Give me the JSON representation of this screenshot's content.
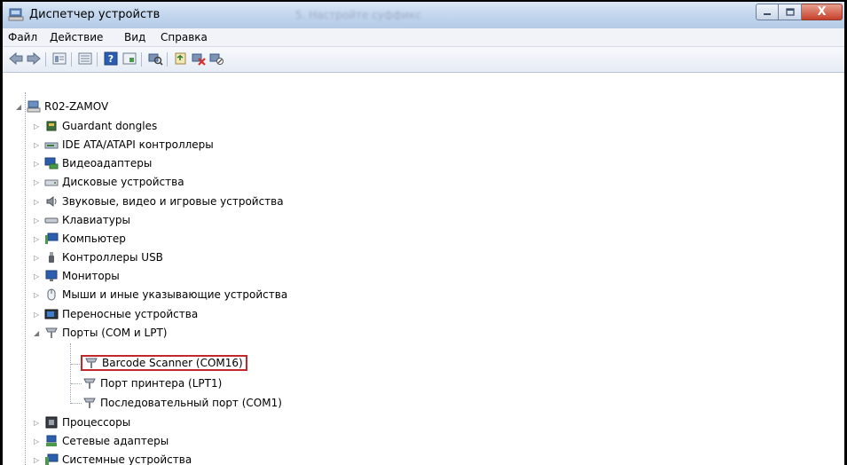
{
  "window": {
    "title": "Диспетчер устройств",
    "ghost_title": "5. Настройте суффикс",
    "close_glyph": "X"
  },
  "menu": [
    {
      "label": "Файл"
    },
    {
      "label": "Действие"
    },
    {
      "label": "Вид"
    },
    {
      "label": "Справка"
    }
  ],
  "toolbar": {
    "icons": [
      "back-icon",
      "forward-icon",
      "properties-pane-icon",
      "list-view-icon",
      "help-icon",
      "device-props-icon",
      "scan-hardware-icon",
      "update-driver-icon",
      "uninstall-icon",
      "disable-icon"
    ]
  },
  "tree": {
    "root": {
      "label": "R02-ZAMOV",
      "expanded": true
    },
    "categories": [
      {
        "label": "Guardant dongles",
        "icon": "dongle-icon"
      },
      {
        "label": "IDE ATA/ATAPI контроллеры",
        "icon": "ide-controller-icon"
      },
      {
        "label": "Видеоадаптеры",
        "icon": "display-adapter-icon"
      },
      {
        "label": "Дисковые устройства",
        "icon": "disk-drive-icon"
      },
      {
        "label": "Звуковые, видео и игровые устройства",
        "icon": "speaker-icon"
      },
      {
        "label": "Клавиатуры",
        "icon": "keyboard-icon"
      },
      {
        "label": "Компьютер",
        "icon": "computer-icon"
      },
      {
        "label": "Контроллеры USB",
        "icon": "usb-icon"
      },
      {
        "label": "Мониторы",
        "icon": "monitor-icon"
      },
      {
        "label": "Мыши и иные указывающие устройства",
        "icon": "mouse-icon"
      },
      {
        "label": "Переносные устройства",
        "icon": "portable-device-icon"
      },
      {
        "label": "Порты (COM и LPT)",
        "icon": "port-icon",
        "expanded": true,
        "children": [
          {
            "label": "Barcode Scanner (COM16)",
            "highlighted": true
          },
          {
            "label": "Порт принтера (LPT1)"
          },
          {
            "label": "Последовательный порт (COM1)"
          }
        ]
      },
      {
        "label": "Процессоры",
        "icon": "processor-icon"
      },
      {
        "label": "Сетевые адаптеры",
        "icon": "network-adapter-icon"
      },
      {
        "label": "Системные устройства",
        "icon": "system-device-icon"
      }
    ]
  },
  "colors": {
    "highlight_border": "#c0282b",
    "titlebar": "#c3d6ee",
    "close_button": "#c6402a"
  }
}
